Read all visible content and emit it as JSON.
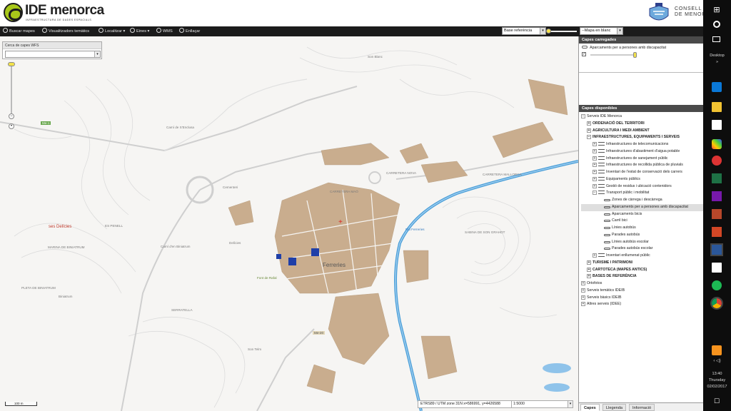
{
  "header": {
    "brand_title": "IDE menorca",
    "brand_subtitle": "INFRAESTRUCTURA DE DADES ESPACIALS",
    "consell_line1": "CONSELL INSULAR",
    "consell_line2": "DE MENORCA"
  },
  "toolbar": {
    "items": [
      "Buscar mapes",
      "Visualitzadors temàtics",
      "Localitzar",
      "Eines",
      "WMS",
      "Enllaçar"
    ],
    "base_select": "Base referència",
    "overlay_select": "--Mapa en blanc"
  },
  "wfs": {
    "title": "Cerca de capes WFS",
    "value": ""
  },
  "map": {
    "labels": [
      "Son Blanc",
      "Cementeri",
      "ses Delícies",
      "ES PENELL",
      "MARINA DE BINIATRUM",
      "PLETA DE BINIATRUM",
      "Biniatrum",
      "Ferreries",
      "Son Telm",
      "SERRATELLA",
      "SABINA DE SON GRAHOT",
      "CARRETERA MAÓ",
      "CARRETERA NOVA",
      "CARRETERA MALLORCA",
      "Camí de S'Enclusa",
      "Camí d'en Biniatrum",
      "Me-1",
      "Me-20",
      "Riu Ferreries",
      "Font de Rafal",
      "Delícies"
    ],
    "scale_bar": "100 m",
    "coords_text": "ETRS89 / UTM zone 31N  x=586991, y=4426588",
    "scale_value": "1:5000"
  },
  "panel": {
    "loaded_title": "Capes carregades",
    "loaded_layer": "Aparcaments per a persones amb discapacitat",
    "loaded_opacity": 1.0,
    "available_title": "Capes disponibles",
    "tree": [
      {
        "label": "Serveis IDE Menorca",
        "level": 0,
        "exp": "−"
      },
      {
        "label": "ORDENACIÓ DEL TERRITORI",
        "level": 1,
        "exp": "+",
        "bold": true
      },
      {
        "label": "AGRICULTURA I MEDI AMBIENT",
        "level": 1,
        "exp": "+",
        "bold": true
      },
      {
        "label": "INFRAESTRUCTURES, EQUIPAMENTS I SERVEIS",
        "level": 1,
        "exp": "−",
        "bold": true
      },
      {
        "label": "Infraestructures de telecomunicacions",
        "level": 2,
        "exp": "+",
        "icon": true
      },
      {
        "label": "Infraestructures d'abastiment d'aigua potable",
        "level": 2,
        "exp": "+",
        "icon": true
      },
      {
        "label": "Infraestructures de sanejament públic",
        "level": 2,
        "exp": "+",
        "icon": true
      },
      {
        "label": "Infraestructures de recollida pública de pluvials",
        "level": 2,
        "exp": "+",
        "icon": true
      },
      {
        "label": "Inventari de l'estat de conservació dels carrers",
        "level": 2,
        "exp": "+",
        "icon": true
      },
      {
        "label": "Equipaments públics",
        "level": 2,
        "exp": "+",
        "icon": true
      },
      {
        "label": "Gestió de residus i ubicació contenidors",
        "level": 2,
        "exp": "+",
        "icon": true
      },
      {
        "label": "Transport públic i mobilitat",
        "level": 2,
        "exp": "−",
        "icon": true
      },
      {
        "label": "Zones de càrrega i descàrrega",
        "level": 3,
        "flat": true
      },
      {
        "label": "Aparcaments per a persones amb discapacitat",
        "level": 3,
        "flat": true,
        "selected": true
      },
      {
        "label": "Aparcaments bicis",
        "level": 3,
        "flat": true
      },
      {
        "label": "Carril bici",
        "level": 3,
        "flat": true
      },
      {
        "label": "Línies autobús",
        "level": 3,
        "flat": true
      },
      {
        "label": "Parades autobús",
        "level": 3,
        "flat": true
      },
      {
        "label": "Línies autobús escolar",
        "level": 3,
        "flat": true
      },
      {
        "label": "Parades autobús escolar",
        "level": 3,
        "flat": true
      },
      {
        "label": "Inventari enllumenat públic",
        "level": 2,
        "exp": "+",
        "icon": true
      },
      {
        "label": "TURISME I PATRIMONI",
        "level": 1,
        "exp": "+",
        "bold": true
      },
      {
        "label": "CARTOTECA (MAPES ANTICS)",
        "level": 1,
        "exp": "+",
        "bold": true
      },
      {
        "label": "BASES DE REFERÈNCIA",
        "level": 1,
        "exp": "+",
        "bold": true
      },
      {
        "label": "Ortofotos",
        "level": 0,
        "exp": "+"
      },
      {
        "label": "Serveis temàtics IDEIB",
        "level": 0,
        "exp": "+"
      },
      {
        "label": "Serveis bàsics IDEIB",
        "level": 0,
        "exp": "+"
      },
      {
        "label": "Altres serveis (IDEE)",
        "level": 0,
        "exp": "+"
      }
    ],
    "tabs": [
      "Capes",
      "Llegenda",
      "Informació"
    ]
  },
  "taskbar": {
    "desktop_label": "Desktop",
    "time": "13:40",
    "day": "Thursday",
    "date": "02/02/2017"
  },
  "colors": {
    "brand_green": "#a8c81a",
    "toolbar_bg": "#1b1b1b",
    "river": "#4a9fd8",
    "buildings": "#c9ad8e",
    "taskbar_bg": "#0d0d0d"
  }
}
